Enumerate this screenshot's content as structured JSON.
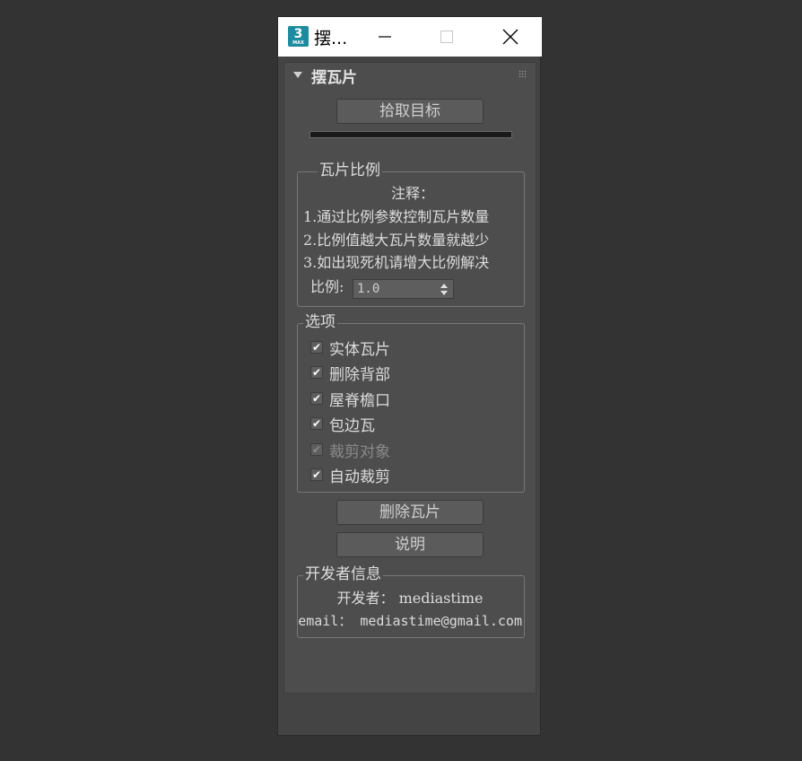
{
  "window": {
    "title": "摆...",
    "app_icon_label": "3",
    "app_icon_sub": "MAX"
  },
  "rollout": {
    "title": "摆瓦片"
  },
  "pick_target": {
    "label": "拾取目标"
  },
  "ratio_group": {
    "label": "瓦片比例",
    "note_title": "注释：",
    "notes": [
      "1.通过比例参数控制瓦片数量",
      "2.比例值越大瓦片数量就越少",
      "3.如出现死机请增大比例解决"
    ],
    "ratio_label": "比例:",
    "ratio_value": "1.0"
  },
  "options_group": {
    "label": "选项",
    "items": [
      {
        "label": "实体瓦片",
        "checked": true,
        "enabled": true
      },
      {
        "label": "删除背部",
        "checked": true,
        "enabled": true
      },
      {
        "label": "屋脊檐口",
        "checked": true,
        "enabled": true
      },
      {
        "label": "包边瓦",
        "checked": true,
        "enabled": true
      },
      {
        "label": "裁剪对象",
        "checked": true,
        "enabled": false
      },
      {
        "label": "自动裁剪",
        "checked": true,
        "enabled": true
      }
    ],
    "check_glyph": "✔"
  },
  "buttons": {
    "delete_tiles": "删除瓦片",
    "help": "说明"
  },
  "developer_group": {
    "label": "开发者信息",
    "developer": "开发者： mediastime",
    "email": "email： mediastime@gmail.com"
  }
}
